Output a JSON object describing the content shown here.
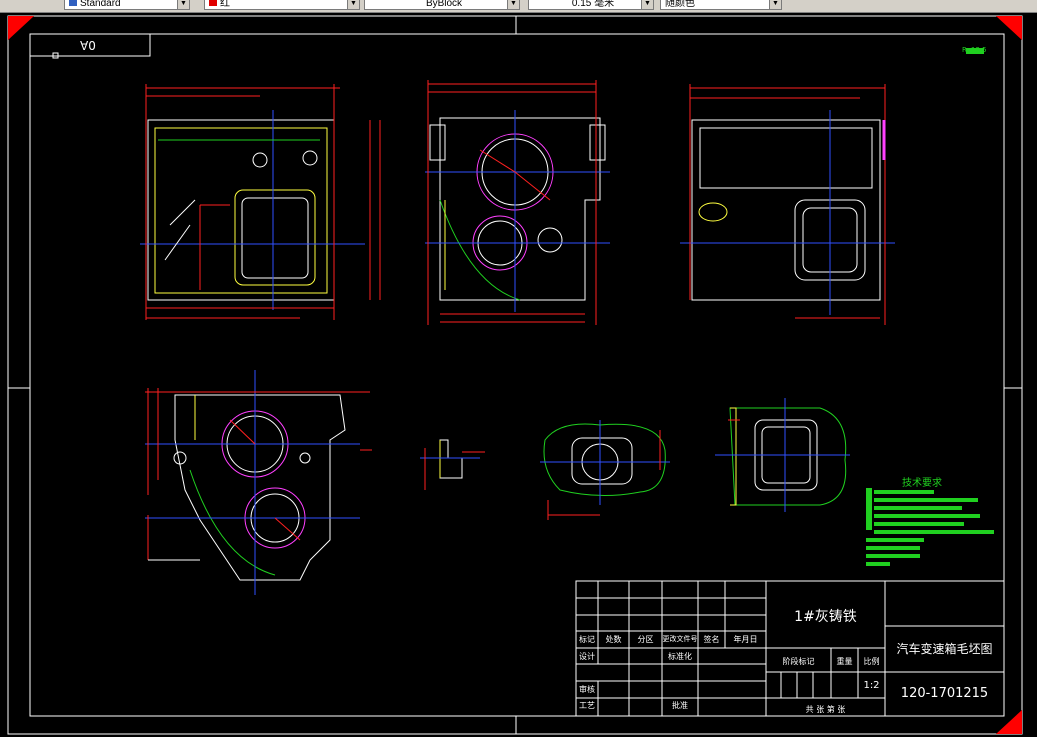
{
  "toolbar": {
    "text_style": "Standard",
    "color_value": "红",
    "linetype": "ByBlock",
    "lineweight": "0.15 毫米",
    "plot_style": "随颜色"
  },
  "drawing": {
    "sheet_label": "0A",
    "corner_mark": "Ra12.5"
  },
  "tech_requirements": {
    "title": "技术要求"
  },
  "title_block": {
    "material": "1#灰铸铁",
    "drawing_name": "汽车变速箱毛坯图",
    "drawing_number": "120-1701215",
    "scale": "1:2",
    "headers": [
      "标记",
      "处数",
      "分区",
      "更改文件号",
      "签名",
      "年月日"
    ],
    "design_label": "设计",
    "standard_label": "标准化",
    "stage_label": "阶段标记",
    "weight_label": "重量",
    "scale_label": "比例",
    "review_label": "审核",
    "process_label": "工艺",
    "approve_label": "批准",
    "sheets_label": "共 张 第 张"
  },
  "colors": {
    "background": "#000000",
    "frame": "#ffffff",
    "dimension": "#ff2020",
    "centerline": "#3050ff",
    "outline": "#ffffff",
    "hatch": "#ffff40",
    "circles": "#ff40ff",
    "green": "#20d020"
  }
}
